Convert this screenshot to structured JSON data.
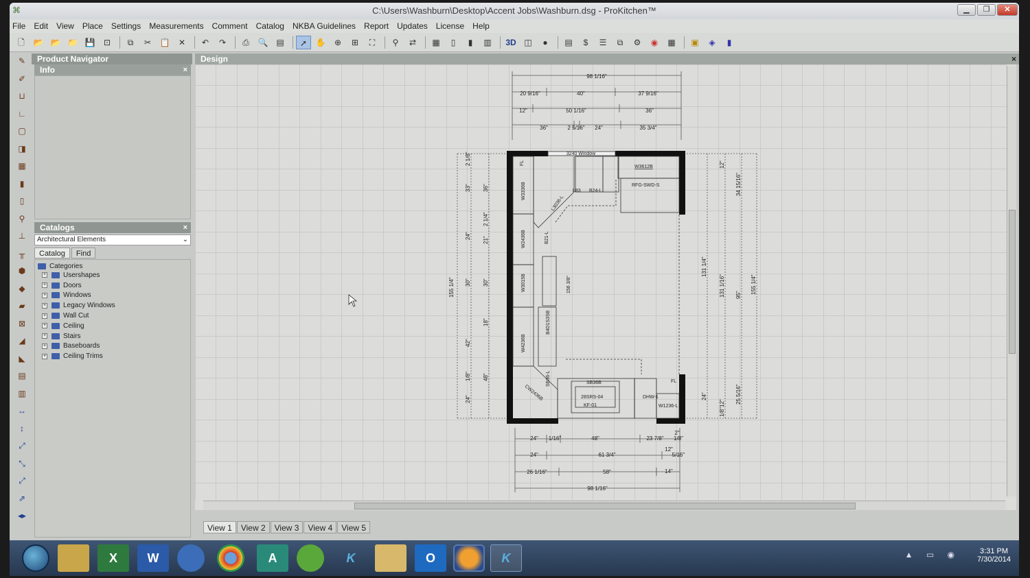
{
  "window": {
    "title": "C:\\Users\\Washburn\\Desktop\\Accent Jobs\\Washburn.dsg - ProKitchen™",
    "minimize": "▁",
    "maximize": "❐",
    "close": "✕"
  },
  "menu": [
    "File",
    "Edit",
    "View",
    "Place",
    "Settings",
    "Measurements",
    "Comment",
    "Catalog",
    "NKBA Guidelines",
    "Report",
    "Updates",
    "License",
    "Help"
  ],
  "toolbar": {
    "buttons": [
      "new-icon",
      "open-icon",
      "open-folder-icon",
      "open-recent-icon",
      "save-icon",
      "save-as-icon",
      "copy-icon",
      "cut-icon",
      "paste-icon",
      "delete-icon",
      "undo-icon",
      "redo-icon",
      "print-icon",
      "print-preview-icon",
      "page-setup-icon",
      "select-arrow-icon",
      "pan-hand-icon",
      "zoom-icon",
      "zoom-window-icon",
      "zoom-extents-icon",
      "find-icon",
      "replace-icon",
      "grid-icon",
      "elevation-icon",
      "wall-elevation-icon",
      "cabinet-icon",
      "3d-view",
      "perspective-icon",
      "render-icon",
      "report-icon",
      "price-icon",
      "list-icon",
      "copy-layout-icon",
      "settings-icon",
      "color-icon",
      "calculator-icon",
      "note-icon",
      "book-icon",
      "help-icon"
    ],
    "3d_label": "3D"
  },
  "left_tools": [
    "pencil-icon",
    "pencil-alt-icon",
    "wall-u-icon",
    "wall-l-icon",
    "room-icon",
    "door-icon",
    "window-icon",
    "cabinet-tall-icon",
    "cabinet-door-icon",
    "faucet-icon",
    "sink-icon",
    "table-icon",
    "appliance-icon",
    "box-icon",
    "counter-icon",
    "pattern-icon",
    "molding-icon",
    "trim-icon",
    "panel-icon",
    "columns-icon",
    "dimension-horizontal-icon",
    "dimension-vertical-icon",
    "dimension-diagonal-icon",
    "dimension-angled-icon",
    "dimension-free-icon",
    "dimension-chain-icon",
    "arrows-icon"
  ],
  "product_navigator": {
    "title": "Product Navigator"
  },
  "info": {
    "title": "Info",
    "close": "×"
  },
  "catalogs": {
    "title": "Catalogs",
    "close": "×",
    "selected": "Architectural Elements",
    "tabs": [
      "Catalog",
      "Find"
    ],
    "root": "Categories",
    "items": [
      "Usershapes",
      "Doors",
      "Windows",
      "Legacy Windows",
      "Wall Cut",
      "Ceiling",
      "Stairs",
      "Baseboards",
      "Ceiling Trims"
    ]
  },
  "design": {
    "title": "Design",
    "close": "×",
    "dims_top": [
      "98 1/16\"",
      "20 9/16\"",
      "40\"",
      "37 9/16\"",
      "12\"",
      "50 1/16\"",
      "36\"",
      "36\"",
      "2 5/16\"",
      "24\"",
      "35 3/4\""
    ],
    "dims_bottom": [
      "24\"",
      "1/16\"",
      "48\"",
      "23 7/8\"",
      "2\"",
      "1/8\"",
      "12\"",
      "24\"",
      "61 3/4\"",
      "5/16\"",
      "26 1/16\"",
      "58\"",
      "14\"",
      "98 1/16\""
    ],
    "dims_left": [
      "155 1/4\"",
      "2 1/8\"",
      "33\"",
      "36\"",
      "24\"",
      "21\"",
      "2 1/4\"",
      "30\"",
      "30\"",
      "18\"",
      "42\"",
      "48\"",
      "1/8\"",
      "24\""
    ],
    "dims_right": [
      "12\"",
      "34 15/16\"",
      "131 1/4\"",
      "131 1/16\"",
      "95\"",
      "155 1/4\"",
      "24\"",
      "1/8\"",
      "12\"",
      "25 5/16\""
    ],
    "labels": {
      "window": "3240 Window",
      "w3612": "W3612B",
      "rfg": "RFG-SWD-S",
      "w3336": "W3336B",
      "l83": "L83",
      "b24": "B24-L",
      "l3036": "L3036-L",
      "w2436": "W2436B",
      "b21": "B21-L",
      "w3015": "W3015B",
      "dim156": "156 3/8\"",
      "b4d": "B4D1S3SB",
      "w4236": "W4236B",
      "b36": "SB36-L",
      "cw": "CW2436B",
      "sb36": "SB36B",
      "sink": "28SRS-04",
      "kf": "KF-01",
      "dhw": "DHW-1",
      "w1236": "W1236-L",
      "fl": "FL",
      "fr": "FL"
    }
  },
  "view_tabs": [
    "View 1",
    "View 2",
    "View 3",
    "View 4",
    "View 5"
  ],
  "taskbar": {
    "apps": [
      "file-explorer-icon",
      "excel-icon",
      "word-icon",
      "pen-icon",
      "chrome-icon",
      "publisher-icon",
      "evernote-icon",
      "prokitchen-icon",
      "paint-icon",
      "outlook-icon",
      "firefox-icon",
      "prokitchen-active-icon"
    ],
    "app_letters": [
      "",
      "X",
      "W",
      "",
      "",
      "A",
      "",
      "K",
      "",
      "O",
      "",
      "K"
    ],
    "time": "3:31 PM",
    "date": "7/30/2014"
  }
}
